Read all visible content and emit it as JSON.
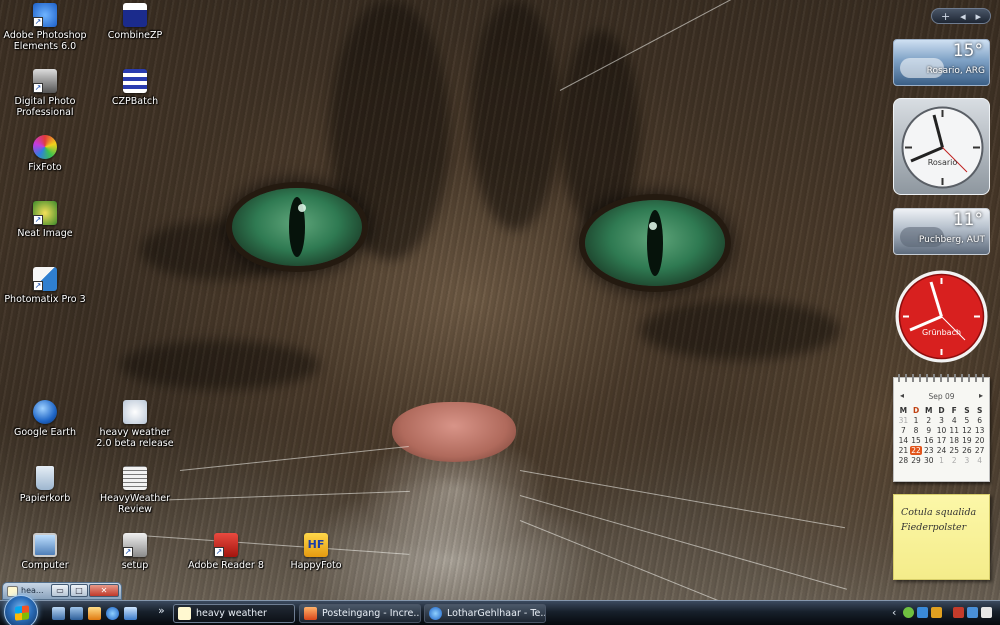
{
  "desktop": {
    "icons": [
      {
        "label": "Adobe Photoshop Elements 6.0",
        "icon": "photoshop-elements-icon",
        "color": "#1c5fc8"
      },
      {
        "label": "CombineZP",
        "icon": "combinezp-icon",
        "color": "#1b2b8c"
      },
      {
        "label": "Digital Photo Professional",
        "icon": "digital-photo-pro-icon",
        "color": "#3c3c3c"
      },
      {
        "label": "CZPBatch",
        "icon": "czpbatch-icon",
        "color": "#2a3cb0"
      },
      {
        "label": "FixFoto",
        "icon": "fixfoto-icon",
        "color": "#d23aa8"
      },
      {
        "label": "Neat Image",
        "icon": "neat-image-icon",
        "color": "#3a8a2a"
      },
      {
        "label": "Photomatix Pro 3",
        "icon": "photomatix-icon",
        "color": "#2f7fd0"
      },
      {
        "label": "Google Earth",
        "icon": "google-earth-icon",
        "color": "#1f66c7"
      },
      {
        "label": "heavy weather 2.0 beta release",
        "icon": "heavy-weather-icon",
        "color": "#e9eef5"
      },
      {
        "label": "Papierkorb",
        "icon": "recycle-bin-icon",
        "color": "#9db6cf"
      },
      {
        "label": "HeavyWeather Review",
        "icon": "heavyweather-review-icon",
        "color": "#d9d9d9"
      },
      {
        "label": "Computer",
        "icon": "computer-icon",
        "color": "#4f7fb8"
      },
      {
        "label": "setup",
        "icon": "setup-icon",
        "color": "#8a8a8a"
      },
      {
        "label": "Adobe Reader 8",
        "icon": "adobe-reader-icon",
        "color": "#c8261e"
      },
      {
        "label": "HappyFoto",
        "icon": "happyfoto-icon",
        "color": "#f2b51b"
      }
    ]
  },
  "sidebar": {
    "controls": {
      "add": "+",
      "prev": "◂",
      "next": "▸"
    },
    "weather1": {
      "temp": "15°",
      "city": "Rosario, ARG"
    },
    "clock1": {
      "label": "Rosario"
    },
    "weather2": {
      "temp": "11°",
      "city": "Puchberg, AUT"
    },
    "clock2": {
      "label": "Grünbach"
    },
    "calendar": {
      "month": "Sep 09",
      "days_of_week": [
        "M",
        "D",
        "M",
        "D",
        "F",
        "S",
        "S"
      ],
      "weeks": [
        [
          "31",
          "1",
          "2",
          "3",
          "4",
          "5",
          "6"
        ],
        [
          "7",
          "8",
          "9",
          "10",
          "11",
          "12",
          "13"
        ],
        [
          "14",
          "15",
          "16",
          "17",
          "18",
          "19",
          "20"
        ],
        [
          "21",
          "22",
          "23",
          "24",
          "25",
          "26",
          "27"
        ],
        [
          "28",
          "29",
          "30",
          "1",
          "2",
          "3",
          "4"
        ]
      ],
      "today": "22"
    },
    "notes": {
      "lines": [
        "Cotula squalida",
        "Fiederpolster"
      ]
    }
  },
  "mini_window": {
    "title": "hea..."
  },
  "taskbar": {
    "overflow": "»",
    "buttons": [
      {
        "label": "heavy weather",
        "icon": "heavy-weather-icon"
      },
      {
        "label": "Posteingang - Incre...",
        "icon": "mail-icon"
      },
      {
        "label": "LotharGehlhaar - Te...",
        "icon": "internet-explorer-icon"
      }
    ],
    "tray_more": "‹"
  },
  "colors": {
    "accent": "#e2551b",
    "taskbar": "#17202b"
  }
}
